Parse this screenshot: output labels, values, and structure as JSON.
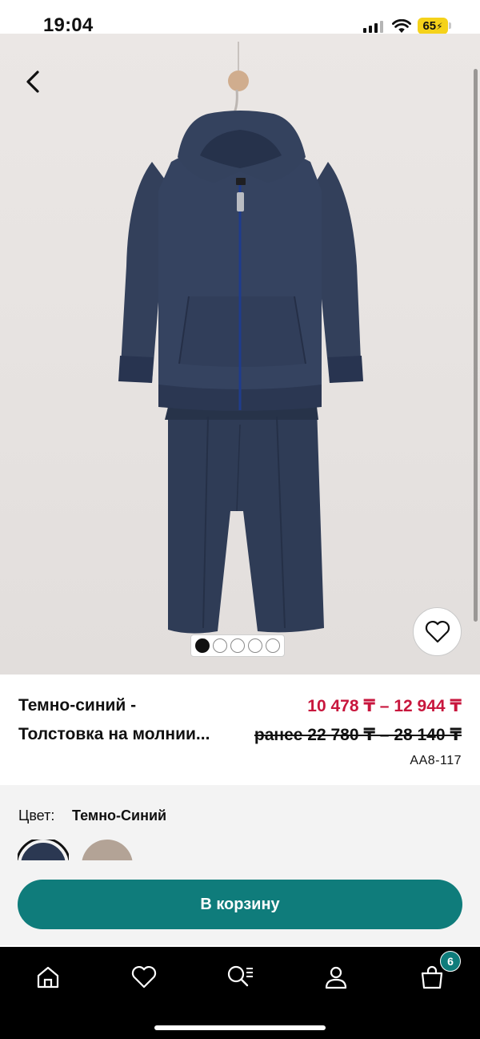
{
  "status_bar": {
    "time": "19:04",
    "battery": "65",
    "icons": [
      "cellular-signal-icon",
      "wifi-icon",
      "battery-charging-icon"
    ]
  },
  "gallery": {
    "image_alt": "navy-blue-zip-hoodie-and-joggers-photo",
    "image_count": 5,
    "active_index": 0,
    "icons": [
      "back-chevron-icon",
      "heart-outline-icon"
    ]
  },
  "product": {
    "title_line1": "Темно-синий -",
    "title_line2": "Толстовка на молнии...",
    "price": "10 478 ₸ – 12 944 ₸",
    "old_price": "ранее 22 780 ₸ – 28 140 ₸",
    "sku": "AA8-117"
  },
  "color": {
    "label": "Цвет:",
    "value": "Темно-Синий",
    "swatches": [
      "#2b3852",
      "#b3a396"
    ]
  },
  "cart_button": {
    "label": "В корзину"
  },
  "bottom_nav": {
    "items": [
      "home-icon",
      "heart-icon",
      "search-list-icon",
      "profile-icon",
      "bag-icon"
    ],
    "cart_count": "6"
  },
  "colors": {
    "accent_teal": "#0f7c7b",
    "price_red": "#c8163d",
    "battery_yellow": "#f5d21a"
  }
}
